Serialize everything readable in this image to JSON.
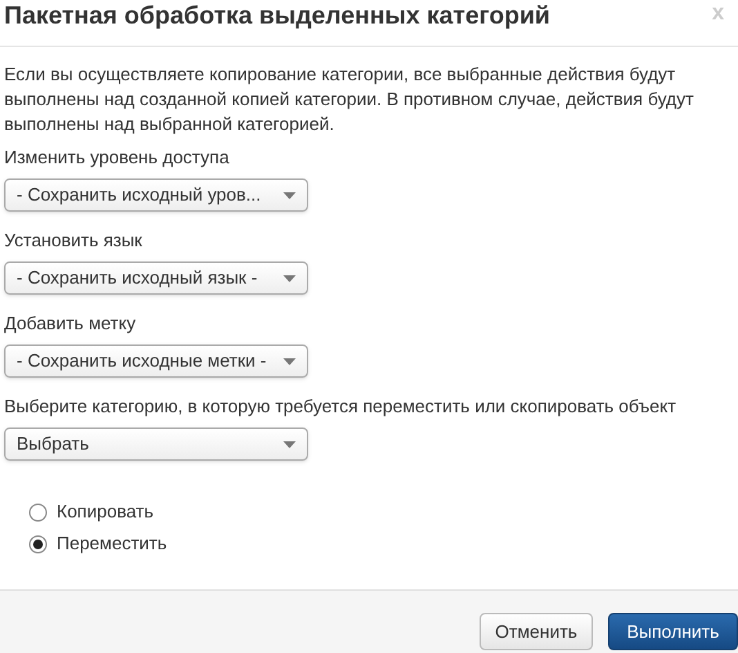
{
  "title": "Пакетная обработка выделенных категорий",
  "close": "x",
  "description": "Если вы осуществляете копирование категории, все выбранные действия будут выполнены над созданной копией категории. В противном случае, действия будут выполнены над выбранной категорией.",
  "fields": [
    {
      "label": "Изменить уровень доступа",
      "value": "- Сохранить исходный уров..."
    },
    {
      "label": "Установить язык",
      "value": "- Сохранить исходный язык -"
    },
    {
      "label": "Добавить метку",
      "value": "- Сохранить исходные метки -"
    },
    {
      "label": "Выберите категорию, в которую требуется переместить или скопировать объект",
      "value": "Выбрать"
    }
  ],
  "options": [
    {
      "label": "Копировать",
      "selected": false
    },
    {
      "label": "Переместить",
      "selected": true
    }
  ],
  "buttons": [
    {
      "label": "Отменить",
      "kind": "secondary"
    },
    {
      "label": "Выполнить",
      "kind": "primary"
    }
  ]
}
